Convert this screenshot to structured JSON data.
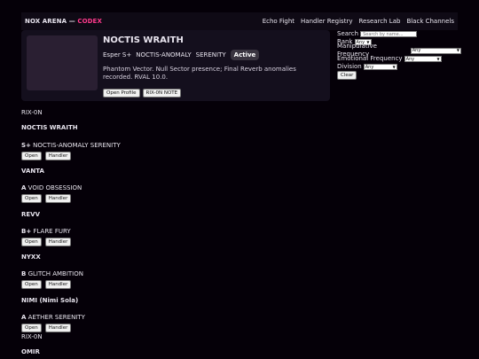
{
  "brand": {
    "name": "NOX ARENA",
    "sep": " — ",
    "highlight": "CODEX"
  },
  "nav": [
    "Echo Fight",
    "Handler Registry",
    "Research Lab",
    "Black Channels"
  ],
  "hero": {
    "title": "NOCTIS WRAITH",
    "tags": [
      "Esper S+",
      "NOCTIS-ANOMALY",
      "SERENITY"
    ],
    "status": "Active",
    "description": "Phantom Vector. Null Sector presence; Final Reverb anomalies recorded. RVAL 10.0.",
    "open_profile": "Open Profile",
    "note_button": "RIX-0N NOTE"
  },
  "filters": {
    "search_label": "Search",
    "search_placeholder": "Search by name...",
    "rank_label": "Rank",
    "rank_value": "Any",
    "manip_label": "Manipulative Frequency",
    "manip_value": "Any",
    "emot_label": "Emotional Frequency",
    "emot_value": "Any",
    "division_label": "Division",
    "division_value": "Any",
    "clear": "Clear"
  },
  "list": {
    "heading": "RIX-0N",
    "open_label": "Open",
    "handler_label": "Handler",
    "entries": [
      {
        "name": "NOCTIS WRAITH",
        "rank": "S+",
        "desc": "NOCTIS-ANOMALY SERENITY"
      },
      {
        "name": "VANTA",
        "rank": "A",
        "desc": "VOID OBSESSION"
      },
      {
        "name": "REVV",
        "rank": "B+",
        "desc": "FLARE FURY"
      },
      {
        "name": "NYXX",
        "rank": "B",
        "desc": "GLITCH AMBITION"
      },
      {
        "name": "NIMI (Nimi Sola)",
        "rank": "A",
        "desc": "AETHER SERENITY"
      },
      {
        "name": "OMIR",
        "rank": "",
        "desc": ""
      }
    ],
    "trailing_note": "RIX-0N"
  }
}
